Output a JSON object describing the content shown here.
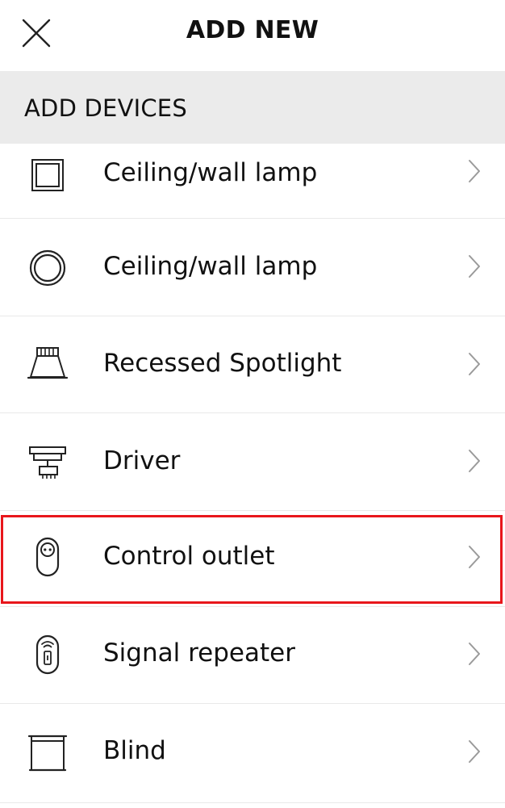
{
  "header": {
    "title": "ADD NEW",
    "close_icon": "close-icon"
  },
  "section": {
    "title": "ADD DEVICES"
  },
  "items": [
    {
      "label": "Ceiling/wall lamp",
      "icon": "square-lamp-icon"
    },
    {
      "label": "Ceiling/wall lamp",
      "icon": "round-lamp-icon"
    },
    {
      "label": "Recessed Spotlight",
      "icon": "spotlight-icon"
    },
    {
      "label": "Driver",
      "icon": "driver-icon"
    },
    {
      "label": "Control outlet",
      "icon": "outlet-icon"
    },
    {
      "label": "Signal repeater",
      "icon": "signal-repeater-icon"
    },
    {
      "label": "Blind",
      "icon": "blind-icon"
    }
  ],
  "colors": {
    "section_background": "#ebebeb",
    "highlight": "#e8161b",
    "chevron": "#9a9a9a"
  }
}
